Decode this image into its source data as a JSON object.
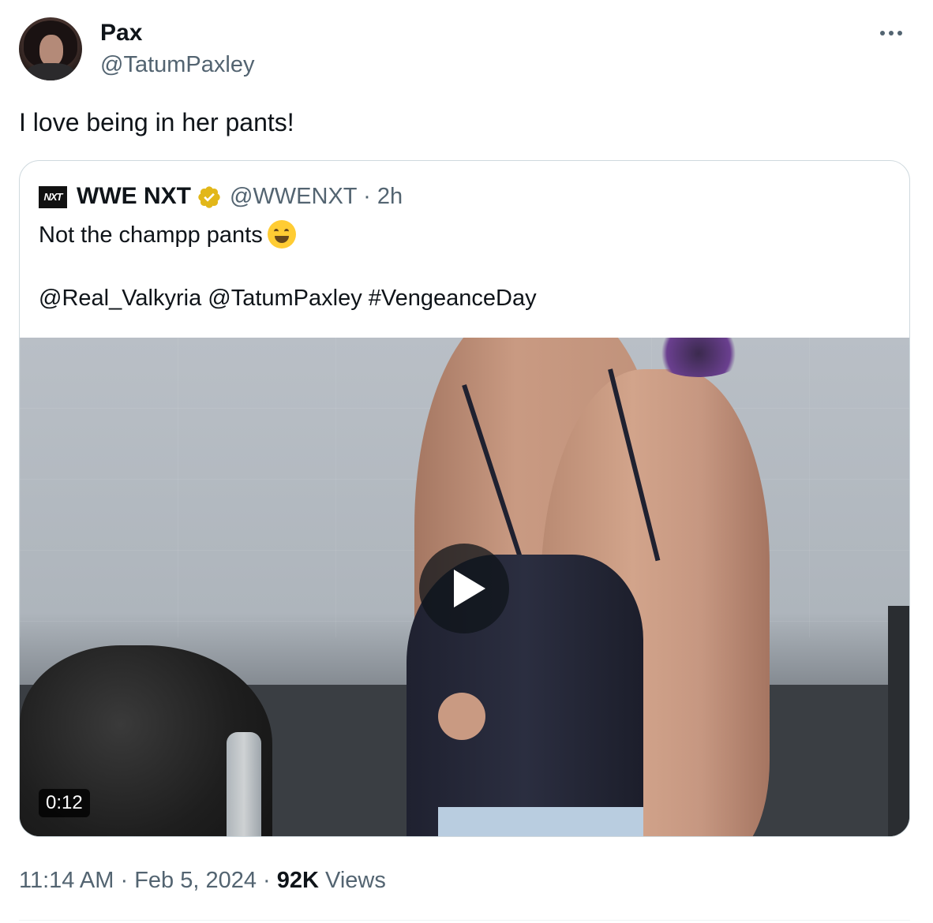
{
  "tweet": {
    "display_name": "Pax",
    "handle": "@TatumPaxley",
    "text": "I love being in her pants!",
    "time": "11:14 AM",
    "date": "Feb 5, 2024",
    "views_count": "92K",
    "views_label": "Views",
    "separator": "·"
  },
  "quote": {
    "logo_text": "NXT",
    "display_name": "WWE NXT",
    "handle": "@WWENXT",
    "age": "2h",
    "line1": "Not the champp pants",
    "line2": "@Real_Valkyria @TatumPaxley #VengeanceDay",
    "video_duration": "0:12"
  },
  "icons": {
    "more": "more-horizontal-icon",
    "verified": "verified-gold-badge-icon",
    "emoji": "grinning-squinting-face-emoji",
    "play": "play-icon"
  },
  "colors": {
    "text": "#0f1419",
    "secondary": "#536471",
    "border": "#cfd9de",
    "verified_gold": "#e2b719"
  }
}
